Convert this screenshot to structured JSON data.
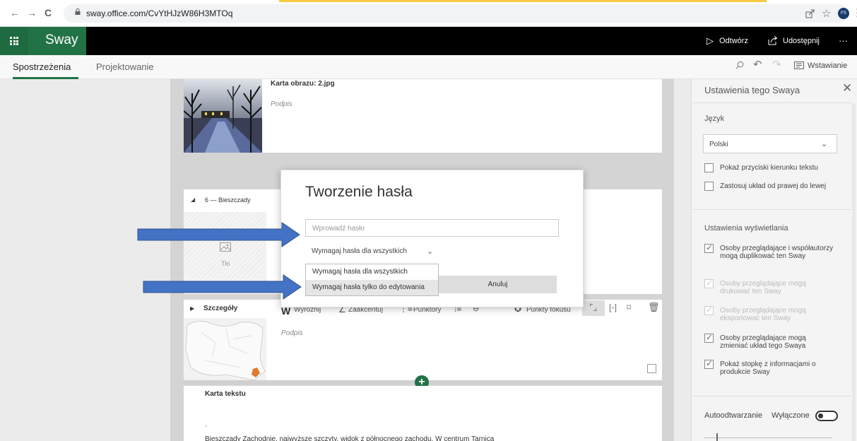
{
  "browser": {
    "url": "sway.office.com/CvYtHJzW86H3MTOq",
    "back_icon": "←",
    "forward_icon": "→",
    "reload_icon": "C",
    "avatar_initials": "FS"
  },
  "appbar": {
    "app_name": "Sway",
    "play_label": "Odtwórz",
    "share_label": "Udostępnij",
    "more_label": "···"
  },
  "tabs": {
    "insights": "Spostrzeżenia",
    "design": "Projektowanie"
  },
  "toolbar": {
    "insert_label": "Wstawianie"
  },
  "story": {
    "image_card_title": "Karta obrazu: 2.jpg",
    "image_caption": "Podpis",
    "section_heading": "6 — Bieszczady",
    "background_label": "Tło",
    "details_label": "Szczegóły",
    "format_emphasize": "Wyróżnij",
    "format_accent": "Zaakcentuj",
    "format_bullets": "Punktory",
    "focus_points": "Punkty fokusu",
    "map_caption": "Podpis",
    "text_card_title": "Karta tekstu",
    "text_dash": "-",
    "text_body": "Bieszczady Zachodnie, najwyższe szczyty, widok z północnego zachodu. W centrum Tarnica"
  },
  "settings_panel": {
    "title": "Ustawienia tego Swaya",
    "language_label": "Język",
    "language_value": "Polski",
    "check1": "Pokaż przyciski kierunku tekstu",
    "check2": "Zastosuj układ od prawej do lewej",
    "display_title": "Ustawienia wyświetlania",
    "opt1": "Osoby przeglądające i współautorzy mogą duplikować ten Sway",
    "opt2": "Osoby przeglądające mogą drukować ten Sway",
    "opt3": "Osoby przeglądające mogą eksportować ten Sway",
    "opt4": "Osoby przeglądające mogą zmieniać układ tego Swaya",
    "opt5": "Pokaż stopkę z informacjami o produkcie Sway",
    "autoplay_label": "Autoodtwarzanie",
    "autoplay_state": "Wyłączone"
  },
  "dialog": {
    "title": "Tworzenie hasła",
    "password_placeholder": "Wprowadź hasło",
    "selected_option": "Wymagaj hasła dla wszystkich",
    "options": [
      "Wymagaj hasła dla wszystkich",
      "Wymagaj hasła tylko do edytowania"
    ],
    "cancel_label": "Anuluj"
  },
  "colors": {
    "brand_green": "#217346",
    "arrow_blue": "#4472c4"
  }
}
